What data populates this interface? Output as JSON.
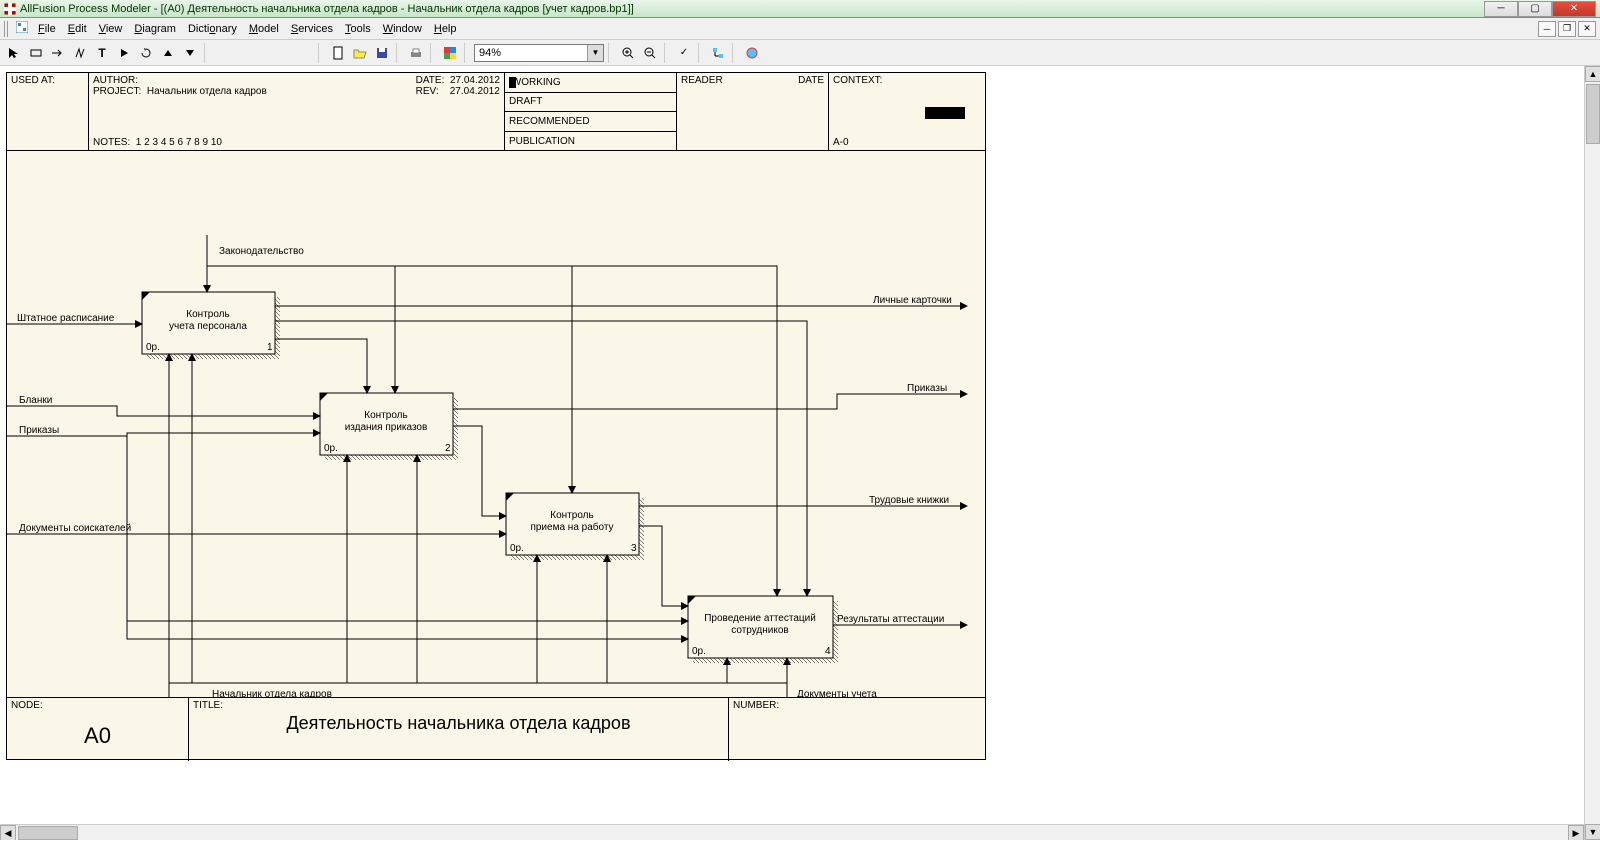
{
  "window": {
    "title": "AllFusion Process Modeler - [(A0) Деятельность начальника  отдела кадров - Начальник отдела кадров  [учет кадров.bp1]]"
  },
  "menu": {
    "file": "File",
    "edit": "Edit",
    "view": "View",
    "diagram": "Diagram",
    "dictionary": "Dictionary",
    "model": "Model",
    "services": "Services",
    "tools": "Tools",
    "window": "Window",
    "help": "Help"
  },
  "toolbar": {
    "zoom": "94%"
  },
  "header": {
    "used_at": "USED AT:",
    "author": "AUTHOR:",
    "project_label": "PROJECT:",
    "project": "Начальник отдела кадров",
    "date_label": "DATE:",
    "date": "27.04.2012",
    "rev_label": "REV:",
    "rev": "27.04.2012",
    "notes_label": "NOTES:",
    "notes": "1  2  3  4  5  6  7  8  9  10",
    "working": "WORKING",
    "draft": "DRAFT",
    "recommended": "RECOMMENDED",
    "publication": "PUBLICATION",
    "reader": "READER",
    "reader_date": "DATE",
    "context": "CONTEXT:",
    "context_val": "A-0"
  },
  "footer": {
    "node_label": "NODE:",
    "node": "A0",
    "title_label": "TITLE:",
    "title": "Деятельность начальника  отдела кадров",
    "number_label": "NUMBER:"
  },
  "boxes": {
    "b1": {
      "line1": "Контроль",
      "line2": "учета персонала",
      "p_label": "0р.",
      "num": "1"
    },
    "b2": {
      "line1": "Контроль",
      "line2": "издания приказов",
      "p_label": "0р.",
      "num": "2"
    },
    "b3": {
      "line1": "Контроль",
      "line2": "приема на работу",
      "p_label": "0р.",
      "num": "3"
    },
    "b4": {
      "line1": "Проведение аттестаций",
      "line2": "сотрудников",
      "p_label": "0р.",
      "num": "4"
    }
  },
  "arrows": {
    "legislation": "Законодательство",
    "staff_schedule": "Штатное расписание",
    "forms": "Бланки",
    "orders_in": "Приказы",
    "applicant_docs": "Документы соискателей",
    "hr_manager": "Начальник отдела кадров",
    "records_docs": "Документы учета",
    "personal_cards": "Личные карточки",
    "orders_out": "Приказы",
    "work_books": "Трудовые книжки",
    "cert_results": "Результаты аттестации"
  },
  "chart_data": {
    "type": "idef0",
    "node": "A0",
    "title": "Деятельность начальника  отдела кадров",
    "activities": [
      {
        "id": 1,
        "name": "Контроль учета персонала",
        "cost": "0р."
      },
      {
        "id": 2,
        "name": "Контроль издания приказов",
        "cost": "0р."
      },
      {
        "id": 3,
        "name": "Контроль приема на работу",
        "cost": "0р."
      },
      {
        "id": 4,
        "name": "Проведение аттестаций сотрудников",
        "cost": "0р."
      }
    ],
    "controls": [
      "Законодательство"
    ],
    "mechanisms": [
      "Начальник отдела кадров",
      "Документы учета"
    ],
    "inputs": [
      "Штатное расписание",
      "Бланки",
      "Приказы",
      "Документы соискателей"
    ],
    "outputs": [
      "Личные карточки",
      "Приказы",
      "Трудовые книжки",
      "Результаты аттестации"
    ]
  }
}
